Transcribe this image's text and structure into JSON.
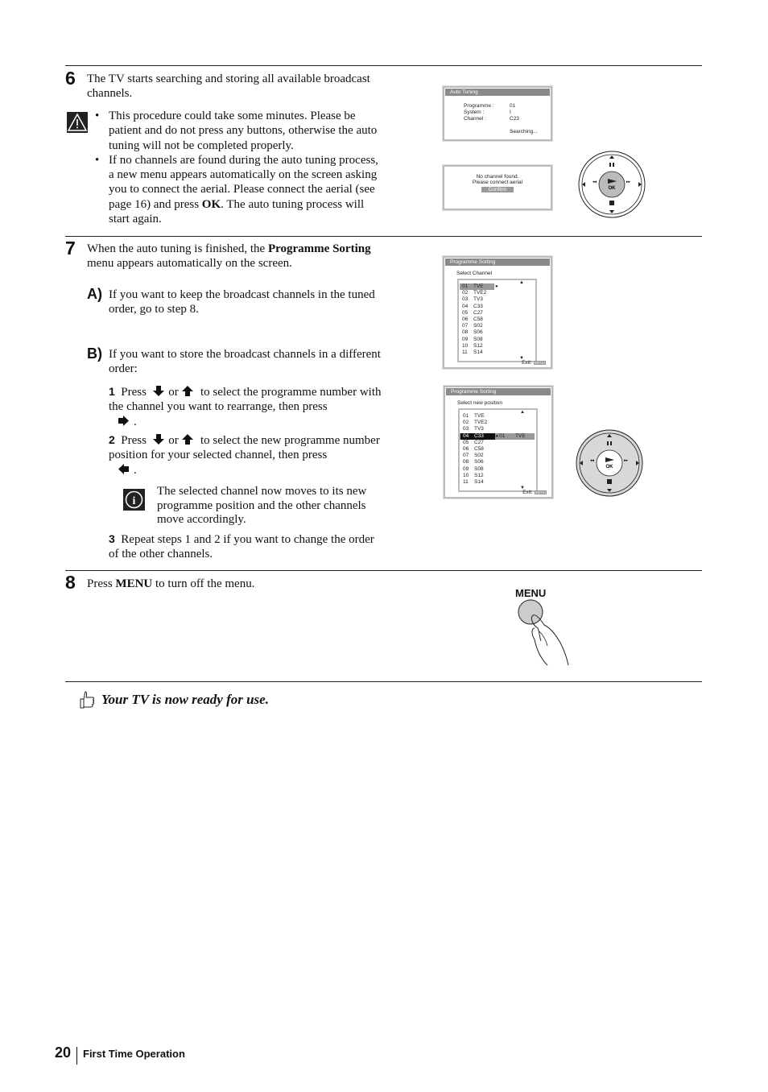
{
  "step6": {
    "number": "6",
    "text": "The TV starts searching and storing all available broadcast channels.",
    "warning_icon": "warning-triangle-icon",
    "bullets": [
      "This procedure could take some minutes. Please be patient and do not press any buttons, otherwise the auto tuning will not be completed properly.",
      {
        "before": "If no channels are found during the auto tuning process, a new menu appears automatically on the screen asking you to connect the aerial. Please connect the aerial (see page 16) and press ",
        "bold": "OK",
        "after": ". The auto tuning process will start again."
      }
    ],
    "auto_tuning_screen": {
      "title": "Auto  Tuning",
      "rows": [
        {
          "label": "Programme :",
          "value": "01"
        },
        {
          "label": "System :",
          "value": "I"
        },
        {
          "label": "Channel :",
          "value": "C23"
        }
      ],
      "status": "Searching..."
    },
    "no_channel_screen": {
      "line1": "No  channel  found.",
      "line2": "Please  connect  aerial",
      "button": "Confirm"
    }
  },
  "step7": {
    "number": "7",
    "text_before": "When the auto tuning is finished, the ",
    "text_bold": "Programme Sorting",
    "text_after": " menu appears automatically on the screen.",
    "option_a": {
      "label": "A)",
      "text": "If you want to keep the broadcast channels in the tuned order, go to step 8."
    },
    "option_b": {
      "label": "B)",
      "text": "If you want to store the broadcast channels in a different order:"
    },
    "substeps": [
      {
        "num": "1",
        "press": "Press",
        "or": "or",
        "text": "to select the programme number with the channel you want to rearrange, then press",
        "end": "."
      },
      {
        "num": "2",
        "press": "Press",
        "or": "or",
        "text": "to select the new programme number position for your selected channel, then press",
        "end": "."
      },
      {
        "num": "3",
        "text": "Repeat steps 1 and 2 if you want to change the order of the other channels."
      }
    ],
    "info_note": "The selected channel now moves to its new programme position and the other channels move accordingly.",
    "sorting_screen_1": {
      "title": "Programme  Sorting",
      "subtitle": "Select Channel",
      "exit": "Exit:",
      "exit_key": "MENU",
      "channels": [
        [
          "01",
          "TVE"
        ],
        [
          "02",
          "TVE2"
        ],
        [
          "03",
          "TV3"
        ],
        [
          "04",
          "C33"
        ],
        [
          "05",
          "C27"
        ],
        [
          "06",
          "C58"
        ],
        [
          "07",
          "S02"
        ],
        [
          "08",
          "S06"
        ],
        [
          "09",
          "S08"
        ],
        [
          "10",
          "S12"
        ],
        [
          "11",
          "S14"
        ]
      ],
      "selected_index": 0
    },
    "sorting_screen_2": {
      "title": "Programme  Sorting",
      "subtitle": "Select new position",
      "exit": "Exit:",
      "exit_key": "MENU",
      "channels": [
        [
          "01",
          "TVE"
        ],
        [
          "02",
          "TVE2"
        ],
        [
          "03",
          "TV3"
        ],
        [
          "04",
          "C33"
        ],
        [
          "05",
          "C27"
        ],
        [
          "06",
          "C58"
        ],
        [
          "07",
          "S02"
        ],
        [
          "08",
          "S06"
        ],
        [
          "09",
          "S08"
        ],
        [
          "10",
          "S12"
        ],
        [
          "11",
          "S14"
        ]
      ],
      "selected_index": 3,
      "moving": {
        "num": "01",
        "name": "TVE"
      }
    },
    "remote_ok_label": "OK"
  },
  "step8": {
    "number": "8",
    "before": "Press ",
    "bold": "MENU",
    "after": " to turn off the menu.",
    "menu_button_label": "MENU"
  },
  "ready": "Your TV is now ready for use.",
  "footer": {
    "page": "20",
    "section": "First Time Operation"
  }
}
